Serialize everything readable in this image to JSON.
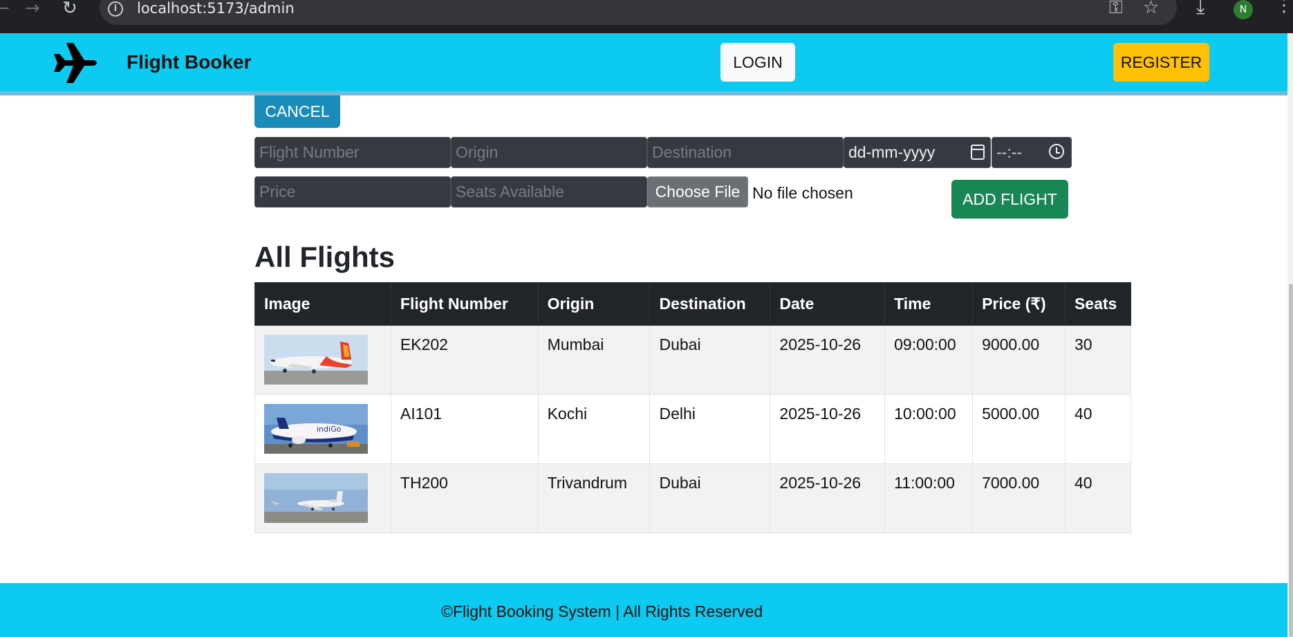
{
  "browser": {
    "url": "localhost:5173/admin",
    "avatar_initial": "N"
  },
  "navbar": {
    "brand": "Flight Booker",
    "login_label": "LOGIN",
    "register_label": "REGISTER",
    "bg_color": "#0dcaf0"
  },
  "form": {
    "cancel_label": "CANCEL",
    "flight_number_placeholder": "Flight Number",
    "origin_placeholder": "Origin",
    "destination_placeholder": "Destination",
    "date_value": "dd-mm-yyyy",
    "time_value": "--:--",
    "price_placeholder": "Price",
    "seats_placeholder": "Seats Available",
    "choose_file_label": "Choose File",
    "no_file_text": "No file chosen",
    "add_label": "ADD FLIGHT"
  },
  "flights": {
    "title": "All Flights",
    "headers": [
      "Image",
      "Flight Number",
      "Origin",
      "Destination",
      "Date",
      "Time",
      "Price (₹)",
      "Seats"
    ],
    "rows": [
      {
        "image": "air-india-express-plane",
        "flight_number": "EK202",
        "origin": "Mumbai",
        "destination": "Dubai",
        "date": "2025-10-26",
        "time": "09:00:00",
        "price": "9000.00",
        "seats": "30"
      },
      {
        "image": "indigo-plane",
        "flight_number": "AI101",
        "origin": "Kochi",
        "destination": "Delhi",
        "date": "2025-10-26",
        "time": "10:00:00",
        "price": "5000.00",
        "seats": "40"
      },
      {
        "image": "private-jet",
        "flight_number": "TH200",
        "origin": "Trivandrum",
        "destination": "Dubai",
        "date": "2025-10-26",
        "time": "11:00:00",
        "price": "7000.00",
        "seats": "40"
      }
    ]
  },
  "footer": {
    "text": "©Flight Booking System | All Rights Reserved"
  }
}
